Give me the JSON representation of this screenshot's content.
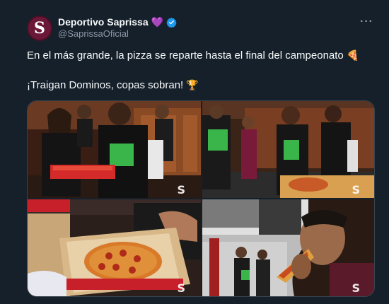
{
  "account": {
    "display_name": "Deportivo Saprissa",
    "heart_emoji": "💜",
    "handle": "@SaprissaOficial",
    "avatar_letter": "S",
    "verified": true
  },
  "menu": {
    "more_label": "···"
  },
  "tweet": {
    "line1": "En el más grande, la pizza se reparte hasta el final del campeonato",
    "line1_emoji": "🍕",
    "line2": "¡Traigan Dominos, copas sobran!",
    "line2_emoji": "🏆"
  },
  "photos": [
    {
      "alt": "photo-locker-room-players-holding-pizza",
      "watermark": "S"
    },
    {
      "alt": "photo-players-eating-pizza-locker-room",
      "watermark": "S"
    },
    {
      "alt": "photo-pizza-box-closeup",
      "watermark": "S"
    },
    {
      "alt": "photo-player-eating-pizza-slice",
      "watermark": "S"
    }
  ],
  "colors": {
    "background": "#15202b",
    "brand_maroon": "#6b1838",
    "verified_blue": "#1d9bf0",
    "muted_text": "#8b98a5"
  }
}
